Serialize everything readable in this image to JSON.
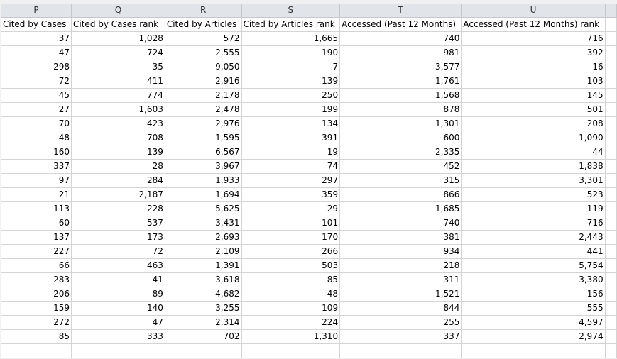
{
  "columns": [
    {
      "letter": "P",
      "header": "Cited by Cases"
    },
    {
      "letter": "Q",
      "header": "Cited by Cases rank"
    },
    {
      "letter": "R",
      "header": "Cited by Articles"
    },
    {
      "letter": "S",
      "header": "Cited by Articles rank"
    },
    {
      "letter": "T",
      "header": "Accessed (Past 12 Months)"
    },
    {
      "letter": "U",
      "header": "Accessed (Past 12 Months) rank"
    }
  ],
  "rows": [
    [
      "37",
      "1,028",
      "572",
      "1,665",
      "740",
      "716"
    ],
    [
      "47",
      "724",
      "2,555",
      "190",
      "981",
      "392"
    ],
    [
      "298",
      "35",
      "9,050",
      "7",
      "3,577",
      "16"
    ],
    [
      "72",
      "411",
      "2,916",
      "139",
      "1,761",
      "103"
    ],
    [
      "45",
      "774",
      "2,178",
      "250",
      "1,568",
      "145"
    ],
    [
      "27",
      "1,603",
      "2,478",
      "199",
      "878",
      "501"
    ],
    [
      "70",
      "423",
      "2,976",
      "134",
      "1,301",
      "208"
    ],
    [
      "48",
      "708",
      "1,595",
      "391",
      "600",
      "1,090"
    ],
    [
      "160",
      "139",
      "6,567",
      "19",
      "2,335",
      "44"
    ],
    [
      "337",
      "28",
      "3,967",
      "74",
      "452",
      "1,838"
    ],
    [
      "97",
      "284",
      "1,933",
      "297",
      "315",
      "3,301"
    ],
    [
      "21",
      "2,187",
      "1,694",
      "359",
      "866",
      "523"
    ],
    [
      "113",
      "228",
      "5,625",
      "29",
      "1,685",
      "119"
    ],
    [
      "60",
      "537",
      "3,431",
      "101",
      "740",
      "716"
    ],
    [
      "137",
      "173",
      "2,693",
      "170",
      "381",
      "2,443"
    ],
    [
      "227",
      "72",
      "2,109",
      "266",
      "934",
      "441"
    ],
    [
      "66",
      "463",
      "1,391",
      "503",
      "218",
      "5,754"
    ],
    [
      "283",
      "41",
      "3,618",
      "85",
      "311",
      "3,380"
    ],
    [
      "206",
      "89",
      "4,682",
      "48",
      "1,521",
      "156"
    ],
    [
      "159",
      "140",
      "3,255",
      "109",
      "844",
      "555"
    ],
    [
      "272",
      "47",
      "2,314",
      "224",
      "255",
      "4,597"
    ],
    [
      "85",
      "333",
      "702",
      "1,310",
      "337",
      "2,974"
    ]
  ]
}
